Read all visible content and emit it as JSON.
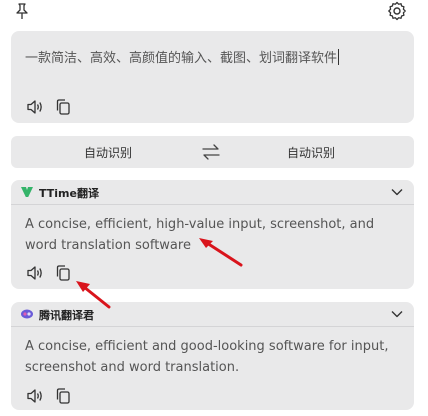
{
  "toolbar": {
    "pin_icon": "pin-icon",
    "settings_icon": "gear-icon"
  },
  "input": {
    "text": "一款简洁、高效、高颜值的输入、截图、划词翻译软件",
    "icons": [
      "speaker-icon",
      "copy-icon"
    ]
  },
  "language": {
    "source": "自动识别",
    "target": "自动识别",
    "swap_icon": "swap-icon"
  },
  "results": [
    {
      "service": "TTime翻译",
      "text": "A concise, efficient, high-value input, screenshot, and word translation software",
      "logo_color": "#35b46a"
    },
    {
      "service": "腾讯翻译君",
      "text": "A concise, efficient and good-looking software for input, screenshot and word translation.",
      "logo_color": "#6a5bd8"
    }
  ],
  "colors": {
    "card_bg": "#e9e9ea",
    "annotation_arrow": "#d9141c"
  }
}
